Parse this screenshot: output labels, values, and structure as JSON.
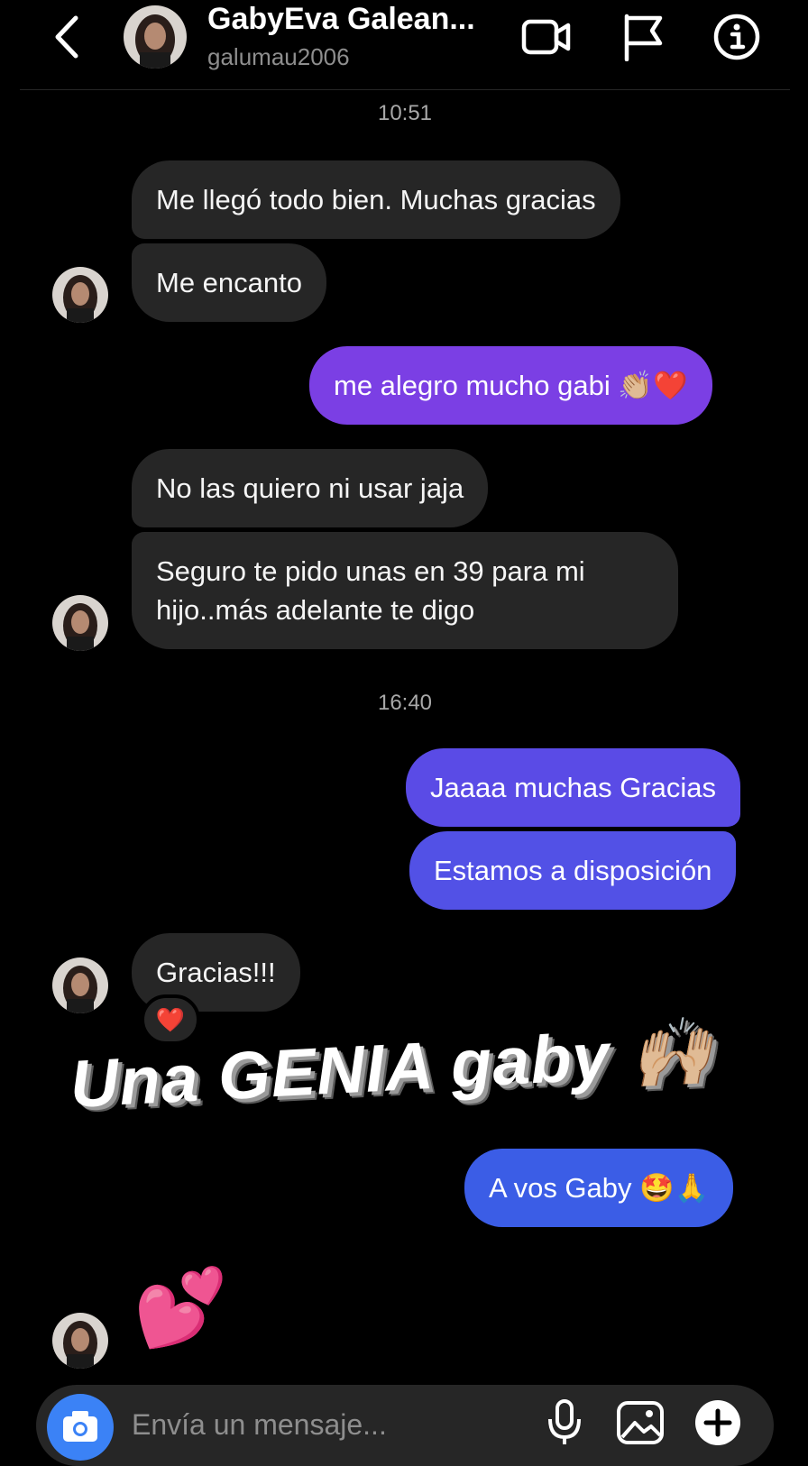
{
  "header": {
    "contact_name": "GabyEva Galean...",
    "username": "galumau2006"
  },
  "timestamps": [
    "10:51",
    "16:40"
  ],
  "messages": [
    {
      "from": "contact",
      "text": "Me llegó todo bien. Muchas gracias"
    },
    {
      "from": "contact",
      "text": "Me encanto"
    },
    {
      "from": "me",
      "text": "me alegro mucho gabi 👏🏼❤️"
    },
    {
      "from": "contact",
      "text": "No las quiero ni usar jaja"
    },
    {
      "from": "contact",
      "text": "Seguro te pido unas en 39 para mi hijo..más adelante te digo"
    },
    {
      "from": "me",
      "text": "Jaaaa muchas Gracias"
    },
    {
      "from": "me",
      "text": "Estamos a disposición"
    },
    {
      "from": "contact",
      "text": "Gracias!!!"
    },
    {
      "from": "me",
      "text": "A vos Gaby 🤩🙏"
    },
    {
      "from": "contact",
      "text": "💕"
    }
  ],
  "reaction": "❤️",
  "overlay_sticker": "Una GENIA gaby 🙌🏼",
  "composer": {
    "placeholder": "Envía un mensaje..."
  },
  "colors": {
    "background": "#000000",
    "incoming_bubble": "#262626",
    "outgoing_gradient_top": "#7b3fe4",
    "outgoing_gradient_bottom": "#3b5de6",
    "camera_button": "#3b82f6"
  },
  "icons": [
    "back-icon",
    "video-call-icon",
    "flag-icon",
    "info-icon",
    "camera-icon",
    "mic-icon",
    "gallery-icon",
    "plus-icon"
  ]
}
